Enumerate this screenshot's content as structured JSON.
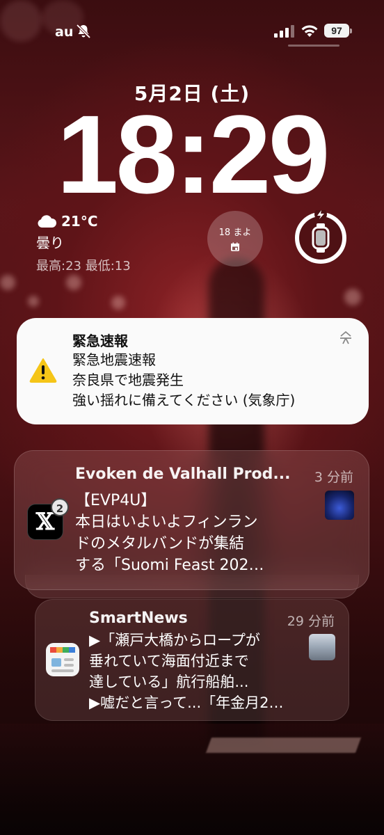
{
  "status_bar": {
    "carrier": "au",
    "battery_level": "97",
    "icons": [
      "bell-slash-icon",
      "cellular-signal-icon",
      "wifi-icon",
      "battery-icon"
    ]
  },
  "lock_screen": {
    "date": "5月2日 (土)",
    "time": "18:29"
  },
  "widgets": {
    "weather": {
      "icon": "cloud-icon",
      "temperature": "21°C",
      "condition": "曇り",
      "high_low": "最高:23 最低:13"
    },
    "calendar": {
      "text": "18 まよ",
      "icon": "calendar-icon"
    },
    "watch_battery": {
      "icon": "apple-watch-charging-icon"
    }
  },
  "notifications": [
    {
      "app_icon": "warning-icon",
      "title": "緊急速報",
      "body_lines": [
        "緊急地震速報",
        "奈良県で地震発生",
        "強い揺れに備えてください (気象庁)"
      ]
    },
    {
      "app_icon": "x-app-icon",
      "badge": "2",
      "title": "Evoken de Valhall Prod...",
      "time": "3 分前",
      "body_lines": [
        "【EVP4U】",
        "本日はいよいよフィンラン",
        "ドのメタルバンドが集結",
        "する「Suomi Feast 202…"
      ]
    },
    {
      "app_icon": "smartnews-app-icon",
      "title": "SmartNews",
      "time": "29 分前",
      "body_lines": [
        "▶「瀬戸大橋からロープが",
        "垂れていて海面付近まで",
        "達している」航行船舶...",
        "▶嘘だと言って...「年金月2…"
      ]
    }
  ],
  "colors": {
    "background": "#5a1519",
    "emergency_card": "#fafafa",
    "warning_yellow": "#f5c518"
  }
}
